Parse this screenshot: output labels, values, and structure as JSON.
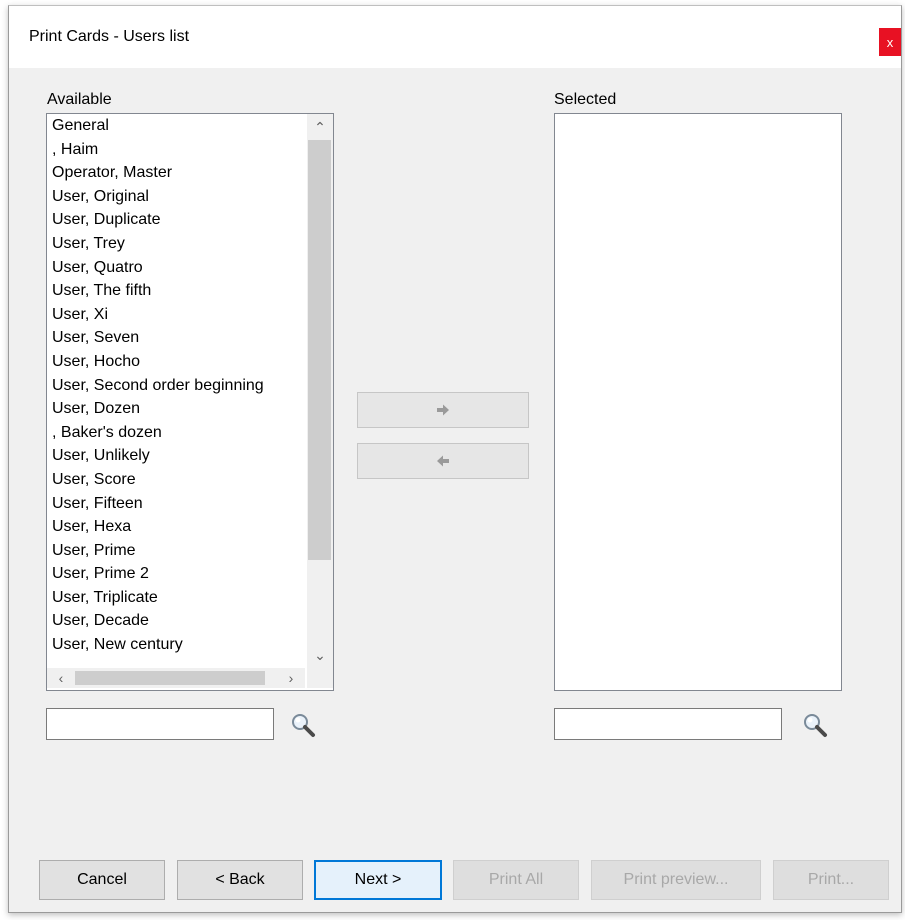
{
  "window": {
    "title": "Print Cards - Users list",
    "close_label": "x"
  },
  "available": {
    "label": "Available",
    "items": [
      "General",
      ", Haim",
      "Operator, Master",
      "User, Original",
      "User, Duplicate",
      "User, Trey",
      "User, Quatro",
      "User, The fifth",
      "User, Xi",
      "User, Seven",
      "User, Hocho",
      "User, Second order beginning",
      "User, Dozen",
      ", Baker's dozen",
      "User, Unlikely",
      "User, Score",
      "User, Fifteen",
      "User, Hexa",
      "User, Prime",
      "User, Prime 2",
      "User, Triplicate",
      "User, Decade",
      "User, New century"
    ],
    "search_value": ""
  },
  "selected": {
    "label": "Selected",
    "items": [],
    "search_value": ""
  },
  "move": {
    "add_icon": "arrow-right-icon",
    "remove_icon": "arrow-left-icon"
  },
  "buttons": {
    "cancel": "Cancel",
    "back": "< Back",
    "next": "Next >",
    "print_all": "Print All",
    "print_preview": "Print preview...",
    "print": "Print..."
  },
  "colors": {
    "close": "#e81123",
    "default_button_border": "#0078d7",
    "disabled_text": "#a8a8a8"
  }
}
